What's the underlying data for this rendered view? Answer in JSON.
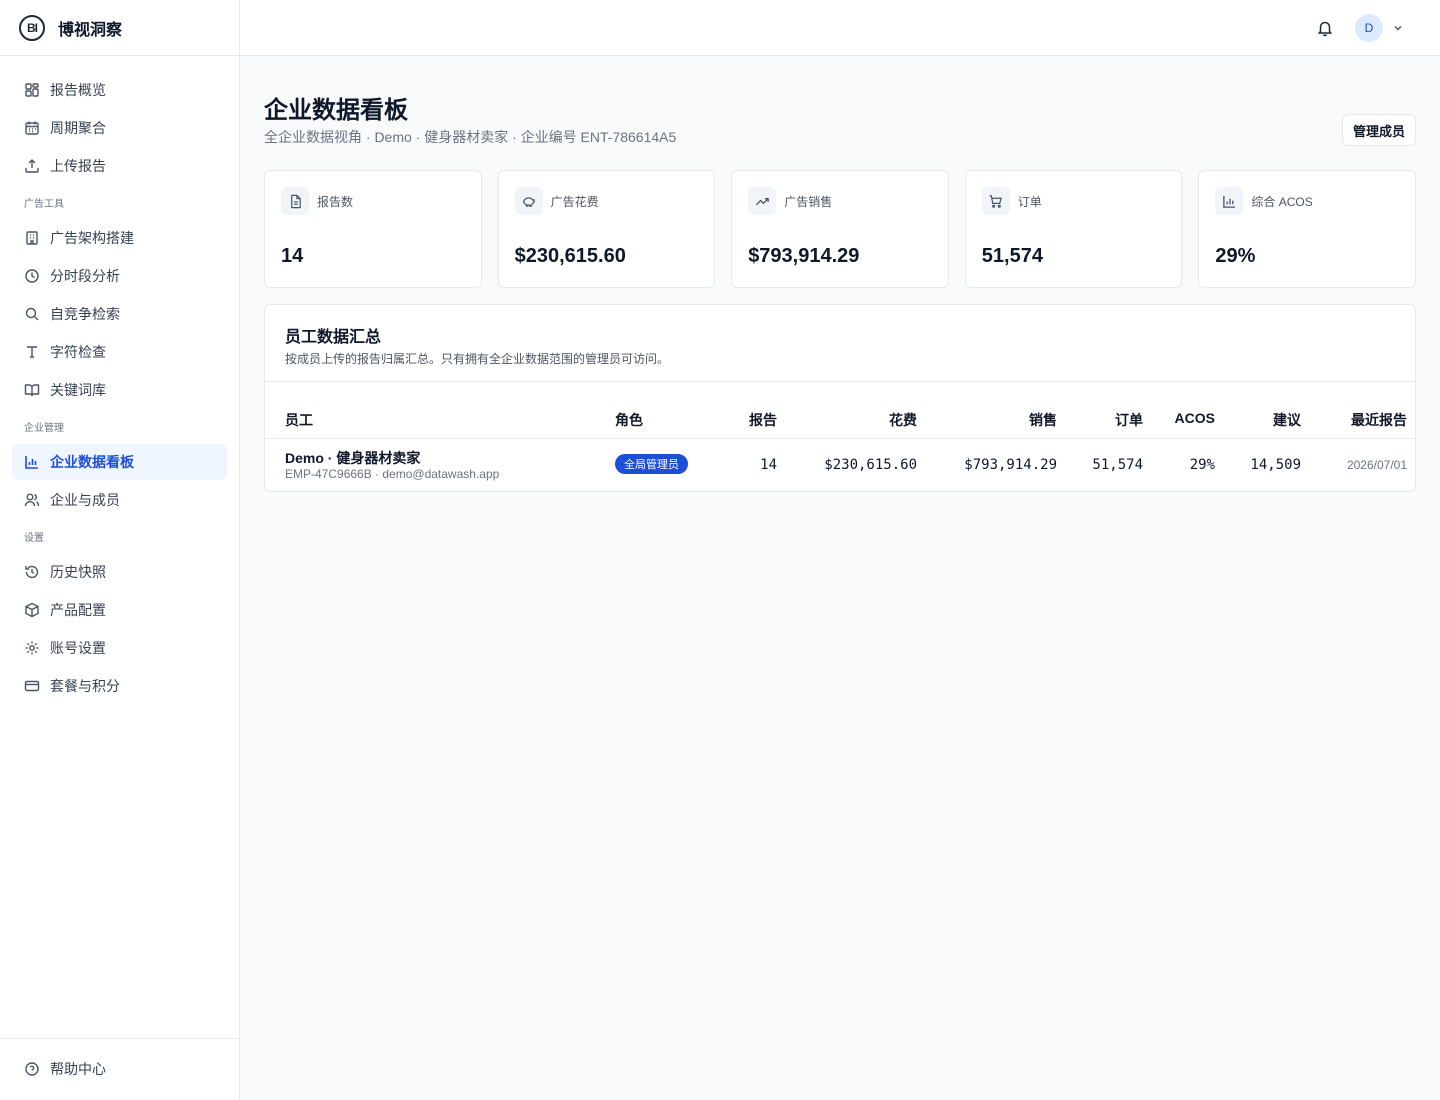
{
  "brand": {
    "logo_text": "BI",
    "name": "博视洞察"
  },
  "sidebar": {
    "main_items": [
      {
        "label": "报告概览",
        "icon": "dashboard-grid-icon"
      },
      {
        "label": "周期聚合",
        "icon": "calendar-icon"
      },
      {
        "label": "上传报告",
        "icon": "upload-icon"
      }
    ],
    "sections": [
      {
        "title": "广告工具",
        "items": [
          {
            "label": "广告架构搭建",
            "icon": "building-icon"
          },
          {
            "label": "分时段分析",
            "icon": "clock-icon"
          },
          {
            "label": "自竞争检索",
            "icon": "search-icon"
          },
          {
            "label": "字符检查",
            "icon": "type-icon"
          },
          {
            "label": "关键词库",
            "icon": "book-icon"
          }
        ]
      },
      {
        "title": "企业管理",
        "items": [
          {
            "label": "企业数据看板",
            "icon": "bar-chart-icon",
            "active": true
          },
          {
            "label": "企业与成员",
            "icon": "users-icon"
          }
        ]
      },
      {
        "title": "设置",
        "items": [
          {
            "label": "历史快照",
            "icon": "history-icon"
          },
          {
            "label": "产品配置",
            "icon": "box-icon"
          },
          {
            "label": "账号设置",
            "icon": "gear-icon"
          },
          {
            "label": "套餐与积分",
            "icon": "credit-card-icon"
          }
        ]
      }
    ],
    "footer": {
      "label": "帮助中心",
      "icon": "help-circle-icon"
    }
  },
  "topbar": {
    "avatar_initial": "D"
  },
  "page": {
    "title": "企业数据看板",
    "subtitle": "全企业数据视角 · Demo · 健身器材卖家 · 企业编号 ENT-786614A5",
    "manage_button": "管理成员"
  },
  "stats": [
    {
      "label": "报告数",
      "value": "14",
      "icon": "file-icon"
    },
    {
      "label": "广告花费",
      "value": "$230,615.60",
      "icon": "piggy-bank-icon"
    },
    {
      "label": "广告销售",
      "value": "$793,914.29",
      "icon": "trending-up-icon"
    },
    {
      "label": "订单",
      "value": "51,574",
      "icon": "cart-icon"
    },
    {
      "label": "综合 ACOS",
      "value": "29%",
      "icon": "bar-chart-icon"
    }
  ],
  "employee_panel": {
    "title": "员工数据汇总",
    "description": "按成员上传的报告归属汇总。只有拥有全企业数据范围的管理员可访问。",
    "columns": [
      "员工",
      "角色",
      "报告",
      "花费",
      "销售",
      "订单",
      "ACOS",
      "建议",
      "最近报告"
    ],
    "rows": [
      {
        "name": "Demo · 健身器材卖家",
        "meta": "EMP-47C9666B · demo@datawash.app",
        "role": "全局管理员",
        "reports": "14",
        "spend": "$230,615.60",
        "sales": "$793,914.29",
        "orders": "51,574",
        "acos": "29%",
        "suggestions": "14,509",
        "last_report": "2026/07/01"
      }
    ]
  },
  "colors": {
    "accent": "#1d4ed8",
    "active_bg": "#eff6ff",
    "border": "#e5e7eb"
  }
}
